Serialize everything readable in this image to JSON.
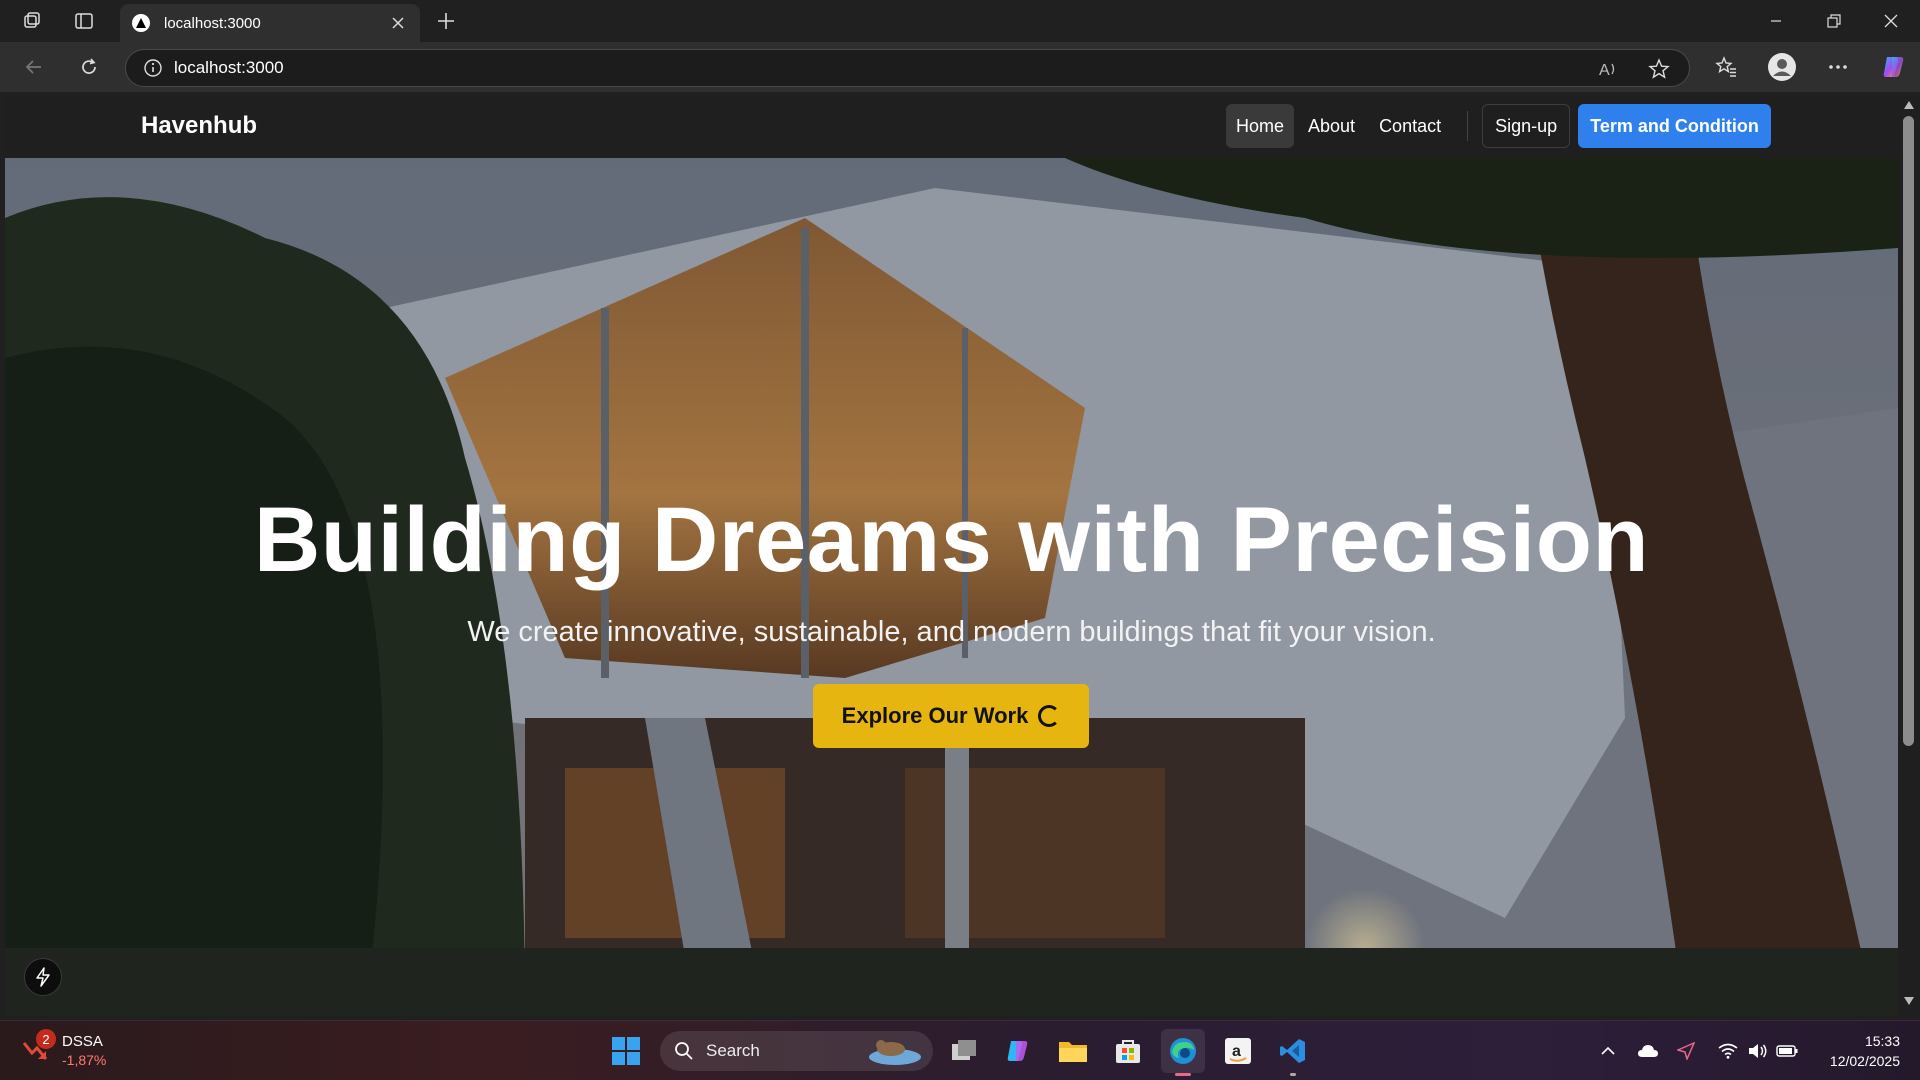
{
  "browser": {
    "tab_title": "localhost:3000",
    "url": "localhost:3000"
  },
  "site": {
    "brand": "Havenhub",
    "nav": [
      {
        "label": "Home",
        "active": true
      },
      {
        "label": "About",
        "active": false
      },
      {
        "label": "Contact",
        "active": false
      }
    ],
    "signup_label": "Sign-up",
    "tnc_label": "Term and Condition"
  },
  "hero": {
    "title": "Building Dreams with Precision",
    "subtitle": "We create innovative, sustainable, and modern buildings that fit your vision.",
    "cta_label": "Explore Our Work"
  },
  "taskbar": {
    "stock_name": "DSSA",
    "stock_change": "-1,87%",
    "stock_badge": "2",
    "search_label": "Search",
    "time": "15:33",
    "date": "12/02/2025"
  },
  "colors": {
    "cta": "#e7b50f",
    "primary_button": "#2f80ed",
    "nav_bg": "#1f1f1f"
  }
}
